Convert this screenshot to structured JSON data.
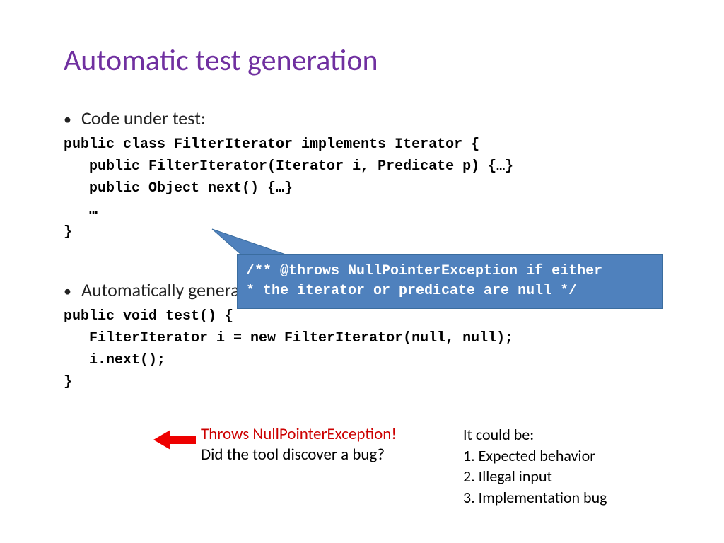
{
  "title": "Automatic test generation",
  "bullet1": "Code under test:",
  "code1": "public class FilterIterator implements Iterator {\n   public FilterIterator(Iterator i, Predicate p) {…}\n   public Object next() {…}\n   …\n}",
  "bullet2": "Automatically generated test:",
  "code2": "public void test() {\n   FilterIterator i = new FilterIterator(null, null);\n   i.next();\n}",
  "callout_line1": "/** @throws NullPointerException if either",
  "callout_line2": " * the iterator or predicate are null */",
  "red_line": "Throws NullPointerException!",
  "black_line": "Did the tool discover a bug?",
  "side0": "It could be:",
  "side1": "1. Expected behavior",
  "side2": "2. Illegal input",
  "side3": "3. Implementation bug"
}
